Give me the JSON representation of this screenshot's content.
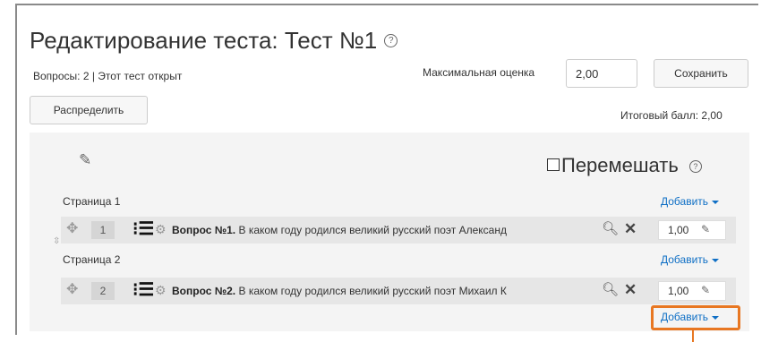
{
  "header": {
    "title": "Редактирование теста: Тест №1",
    "help_glyph": "?",
    "question_info": "Вопросы: 2 | Этот тест открыт",
    "max_grade_label": "Максимальная оценка",
    "max_grade_value": "2,00",
    "save_label": "Сохранить",
    "repaginate_label": "Распределить",
    "total_label": "Итоговый балл: 2,00"
  },
  "section": {
    "shuffle_label": "Перемешать",
    "add_label": "Добавить",
    "pages": [
      {
        "label": "Страница 1",
        "question": {
          "number": "1",
          "title": "Вопрос №1.",
          "text": " В каком году родился великий русский поэт Александ",
          "mark": "1,00"
        }
      },
      {
        "label": "Страница 2",
        "question": {
          "number": "2",
          "title": "Вопрос №2.",
          "text": " В каком году родился великий русский поэт Михаил К",
          "mark": "1,00"
        }
      }
    ]
  },
  "colors": {
    "link": "#0f6fc5",
    "highlight": "#e87722"
  },
  "icons": [
    "help-icon",
    "pencil-icon",
    "move-icon",
    "list-icon",
    "gear-icon",
    "search-icon",
    "delete-icon",
    "page-break-icon"
  ]
}
